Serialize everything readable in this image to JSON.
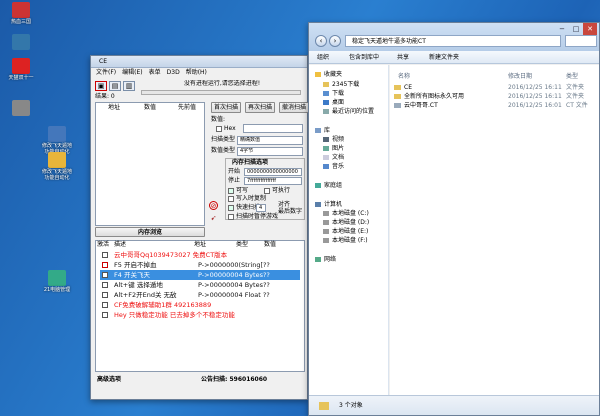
{
  "desktop": {
    "icons": [
      {
        "label": "热血三国",
        "color": "#c33"
      },
      {
        "label": "",
        "color": "#37a"
      },
      {
        "label": "天猫双十一",
        "color": "#d22"
      },
      {
        "label": "",
        "color": "#888"
      },
      {
        "label": "修改飞天遁地\n功能自动化",
        "color": "#47b"
      },
      {
        "label": "修改飞天遁地\n功能自动化",
        "color": "#e8b53a"
      },
      {
        "label": "21电脑管理",
        "color": "#3a8"
      }
    ]
  },
  "ce": {
    "title": "CE",
    "menu": [
      "文件(F)",
      "编辑(E)",
      "表单",
      "D3D",
      "帮助(H)"
    ],
    "process_text": "没有进程运行,请您选择进程!",
    "found_label": "结果: 0",
    "columns": [
      "地址",
      "数值",
      "先前值"
    ],
    "first_scan": "首次扫描",
    "next_scan": "再次扫描",
    "undo_scan": "撤消扫描",
    "value_label": "数值:",
    "hex_label": "Hex",
    "scan_type_label": "扫描类型",
    "scan_type_value": "精确数值",
    "value_type_label": "数值类型",
    "value_type_value": "4字节",
    "mem_options": "内存扫描选项",
    "start_label": "开始",
    "start_value": "0000000000000000",
    "stop_label": "停止",
    "stop_value": "7fffffffffffffff",
    "writable": "可写",
    "executable": "可执行",
    "copy_on_write": "写入时复制",
    "fast_scan": "快速扫描",
    "alignment": "对齐",
    "last_digits": "最后数字",
    "fast_value": "4",
    "pause": "扫描时暂停游戏",
    "memory_view": "内存浏览",
    "table_headers": [
      "激活",
      "描述",
      "地址",
      "类型",
      "数值"
    ],
    "rows": [
      {
        "desc": "云中哥哥Qq1039473027  免费CT版本",
        "addr": "",
        "color": "#e11"
      },
      {
        "desc": "F5  开启不掉血",
        "addr": "P->0000000(String[??",
        "color": "#111"
      },
      {
        "desc": "F4  开关飞天",
        "addr": "P->00000004  Bytes??",
        "color": "#fff"
      },
      {
        "desc": "Alt+键  选择遁地",
        "addr": "P->00000004  Bytes??",
        "color": "#111"
      },
      {
        "desc": "Alt+F2开End关 无敌",
        "addr": "P->00000004 Float  ??",
        "color": "#111"
      },
      {
        "desc": "CF免费破解辅助1群    492163889",
        "addr": "",
        "color": "#e11"
      },
      {
        "desc": "Hey 只做稳定功能 已去掉多个不稳定功能",
        "addr": "",
        "color": "#e11"
      }
    ],
    "advanced": "高级选项",
    "footer_text": "公告扫描: 596016060"
  },
  "explorer": {
    "address": "稳定飞天遁地牛逼多功能CT",
    "commands": [
      "组织",
      "包含到库中",
      "共享",
      "新建文件夹"
    ],
    "nav": {
      "favorites": "收藏夹",
      "fav_items": [
        "2345下载",
        "下载",
        "桌面",
        "最近访问的位置"
      ],
      "library": "库",
      "lib_items": [
        "视频",
        "图片",
        "文档",
        "音乐"
      ],
      "homegroup": "家庭组",
      "computer": "计算机",
      "drives": [
        "本地磁盘 (C:)",
        "本地磁盘 (D:)",
        "本地磁盘 (E:)",
        "本地磁盘 (F:)"
      ],
      "network": "网络"
    },
    "columns": [
      "名称",
      "修改日期",
      "类型"
    ],
    "files": [
      {
        "name": "CE",
        "date": "2016/12/25 16:11",
        "type": "文件夹",
        "color": "#e6c35a"
      },
      {
        "name": "全新所有图标永久可用",
        "date": "2016/12/25 16:11",
        "type": "文件夹",
        "color": "#e6c35a"
      },
      {
        "name": "云中哥哥.CT",
        "date": "2016/12/25 16:01",
        "type": "CT 文件",
        "color": "#9ab"
      }
    ],
    "status": "3 个对象"
  }
}
